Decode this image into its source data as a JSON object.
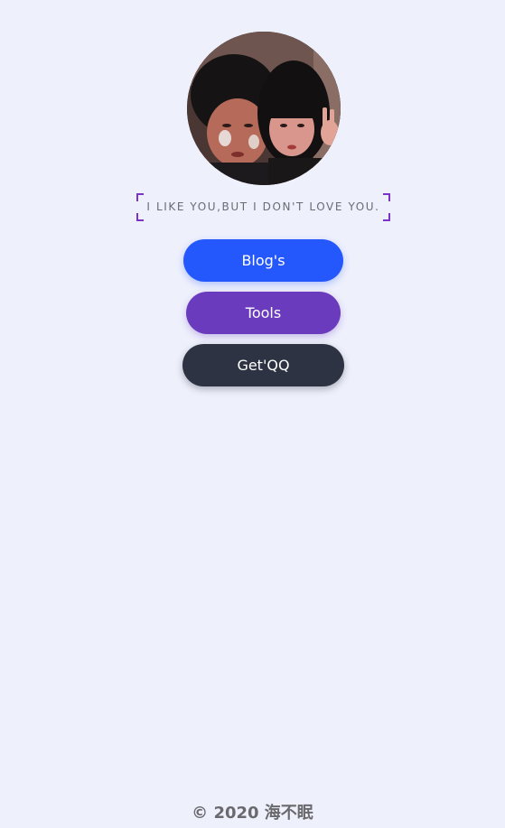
{
  "profile": {
    "avatar_alt": "avatar-photo"
  },
  "motto": {
    "text": "I LIKE YOU,BUT I DON'T LOVE YOU."
  },
  "buttons": {
    "blog": "Blog's",
    "tools": "Tools",
    "qq": "Get'QQ"
  },
  "footer": {
    "copyright": "© 2020 海不眠"
  },
  "colors": {
    "background": "#eef0fc",
    "blog_button": "#2458fd",
    "tools_button": "#6a3bbd",
    "qq_button": "#2d3342",
    "bracket_accent": "#7a35c8"
  }
}
